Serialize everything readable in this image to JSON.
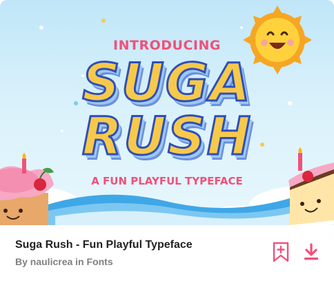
{
  "preview": {
    "intro_text": "INTRODUCING",
    "word1": "SUGA",
    "word2": "RUSH",
    "tagline": "A FUN PLAYFUL TYPEFACE"
  },
  "item": {
    "title": "Suga Rush - Fun Playful Typeface",
    "by_prefix": "By",
    "author": "naulicrea",
    "in_prefix": "in",
    "category": "Fonts"
  },
  "actions": {
    "bookmark_icon": "bookmark-add-icon",
    "download_icon": "download-icon"
  },
  "colors": {
    "accent": "#f0517a",
    "title": "#222222",
    "meta": "#808080",
    "sky": "#bfe6f8"
  }
}
